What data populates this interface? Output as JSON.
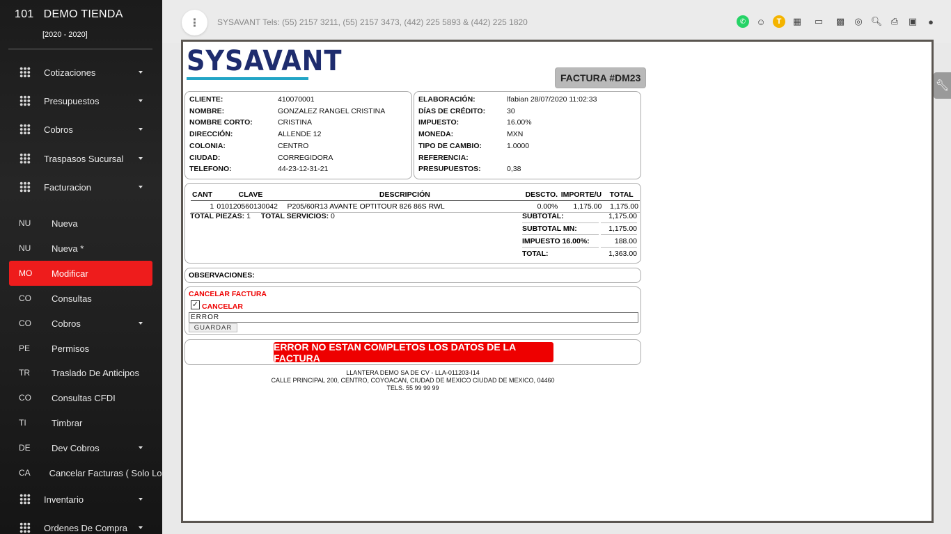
{
  "sidebar": {
    "store_number": "101",
    "store_name": "DEMO TIENDA",
    "years": "[2020 - 2020]",
    "sections": [
      {
        "label": "Cotizaciones"
      },
      {
        "label": "Presupuestos"
      },
      {
        "label": "Cobros"
      },
      {
        "label": "Traspasos Sucursal"
      },
      {
        "label": "Facturacion"
      }
    ],
    "sub_items": [
      {
        "abbr": "NU",
        "label": "Nueva"
      },
      {
        "abbr": "NU",
        "label": "Nueva *"
      },
      {
        "abbr": "MO",
        "label": "Modificar"
      },
      {
        "abbr": "CO",
        "label": "Consultas"
      },
      {
        "abbr": "CO",
        "label": "Cobros"
      },
      {
        "abbr": "PE",
        "label": "Permisos"
      },
      {
        "abbr": "TR",
        "label": "Traslado De Anticipos"
      },
      {
        "abbr": "CO",
        "label": "Consultas CFDI"
      },
      {
        "abbr": "TI",
        "label": "Timbrar"
      },
      {
        "abbr": "DE",
        "label": "Dev Cobros"
      },
      {
        "abbr": "CA",
        "label": "Cancelar Facturas ( Solo Local"
      }
    ],
    "bottom_sections": [
      {
        "label": "Inventario"
      },
      {
        "label": "Ordenes De Compra"
      }
    ],
    "active_color": "#ee1c1c"
  },
  "topbar": {
    "menu_glyph": "⋮",
    "tels": "SYSAVANT Tels: (55) 2157 3211, (55) 2157 3473, (442) 225 5893 & (442) 225 1820",
    "icons": [
      "whatsapp-icon",
      "support-agent-icon",
      "t-badge-icon",
      "dashboard-icon",
      "keyboard-icon",
      "qr-icon",
      "tire-icon",
      "search-document-icon",
      "print-icon",
      "calendar-icon",
      "user-icon"
    ],
    "t_badge": "T"
  },
  "invoice": {
    "logo_text": "SYSAVANT",
    "badge": "FACTURA #DM23",
    "client": [
      {
        "k": "CLIENTE:",
        "v": "410070001"
      },
      {
        "k": "NOMBRE:",
        "v": "GONZALEZ RANGEL CRISTINA"
      },
      {
        "k": "NOMBRE CORTO:",
        "v": "CRISTINA"
      },
      {
        "k": "DIRECCIÓN:",
        "v": "ALLENDE 12"
      },
      {
        "k": "COLONIA:",
        "v": "CENTRO"
      },
      {
        "k": "CIUDAD:",
        "v": "CORREGIDORA"
      },
      {
        "k": "TELEFONO:",
        "v": "44-23-12-31-21"
      }
    ],
    "meta": [
      {
        "k": "ELABORACIÓN:",
        "v": "lfabian 28/07/2020 11:02:33"
      },
      {
        "k": "DÍAS DE CRÉDITO:",
        "v": "30"
      },
      {
        "k": "IMPUESTO:",
        "v": "16.00%"
      },
      {
        "k": "MONEDA:",
        "v": "MXN"
      },
      {
        "k": "TIPO DE CAMBIO:",
        "v": "1.0000"
      },
      {
        "k": "REFERENCIA:",
        "v": ""
      },
      {
        "k": "PRESUPUESTOS:",
        "v": "0,38"
      }
    ],
    "columns": {
      "cant": "CANT",
      "clave": "CLAVE",
      "descripcion": "DESCRIPCIÓN",
      "descto": "DESCTO.",
      "importe": "IMPORTE/U",
      "total": "TOTAL"
    },
    "rows": [
      {
        "cant": "1",
        "clave": "010120560130042",
        "descripcion": "P205/60R13 AVANTE OPTITOUR 826 86S RWL",
        "descto": "0.00%",
        "importe": "1,175.00",
        "total": "1,175.00"
      }
    ],
    "piezas_label": "TOTAL PIEZAS:",
    "piezas": "1",
    "servicios_label": "TOTAL SERVICIOS:",
    "servicios": "0",
    "totals": [
      {
        "k": "SUBTOTAL:",
        "v": "1,175.00"
      },
      {
        "k": "SUBTOTAL MN:",
        "v": "1,175.00"
      },
      {
        "k": "IMPUESTO 16.00%:",
        "v": "188.00"
      },
      {
        "k": "TOTAL:",
        "v": "1,363.00"
      }
    ],
    "observaciones": "OBSERVACIONES:",
    "cancel_title": "CANCELAR FACTURA",
    "cancel_checkbox": "CANCELAR",
    "cancel_checked": true,
    "cancel_reason": "ERROR",
    "save_label": "GUARDAR",
    "error_message": "ERROR NO ESTAN COMPLETOS LOS DATOS DE LA FACTURA",
    "footer": [
      "LLANTERA DEMO SA DE CV - LLA-011203-I14",
      "CALLE PRINCIPAL 200, CENTRO, COYOACAN, CIUDAD DE MEXICO CIUDAD DE MEXICO, 04460",
      "TELS. 55 99 99 99"
    ]
  }
}
